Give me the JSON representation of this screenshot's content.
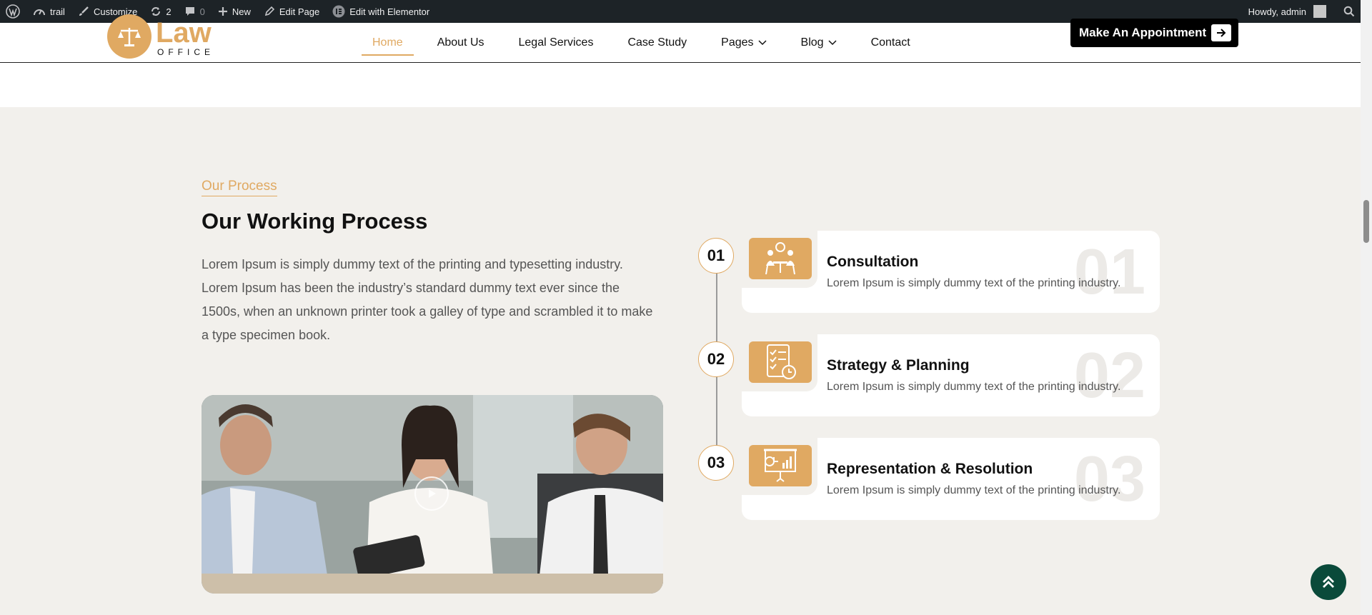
{
  "adminbar": {
    "site": "trail",
    "customize": "Customize",
    "updates": "2",
    "comments": "0",
    "new": "New",
    "edit_page": "Edit Page",
    "elementor": "Edit with Elementor",
    "howdy": "Howdy, admin"
  },
  "header": {
    "logo_main": "Law",
    "logo_sub": "OFFICE",
    "nav": [
      "Home",
      "About Us",
      "Legal Services",
      "Case Study",
      "Pages",
      "Blog",
      "Contact"
    ],
    "cta": "Make An Appointment"
  },
  "process": {
    "eyebrow": "Our Process",
    "heading": "Our Working Process",
    "lead": "Lorem Ipsum is simply dummy text of the printing and typesetting industry. Lorem Ipsum has been the industry’s standard dummy text ever since the 1500s, when an unknown printer took a galley of type and scrambled it to make a type specimen book.",
    "steps": [
      {
        "num": "01",
        "title": "Consultation",
        "text": "Lorem Ipsum is simply dummy text of the printing industry.",
        "icon": "meeting-icon"
      },
      {
        "num": "02",
        "title": "Strategy & Planning",
        "text": "Lorem Ipsum is simply dummy text of the printing industry.",
        "icon": "checklist-icon"
      },
      {
        "num": "03",
        "title": "Representation & Resolution",
        "text": "Lorem Ipsum is simply dummy text of the printing industry.",
        "icon": "presentation-icon"
      }
    ]
  },
  "colors": {
    "accent": "#e0a962",
    "section_bg": "#f2f0ec",
    "admin_bar": "#1d2327",
    "to_top": "#0a4a3a"
  }
}
